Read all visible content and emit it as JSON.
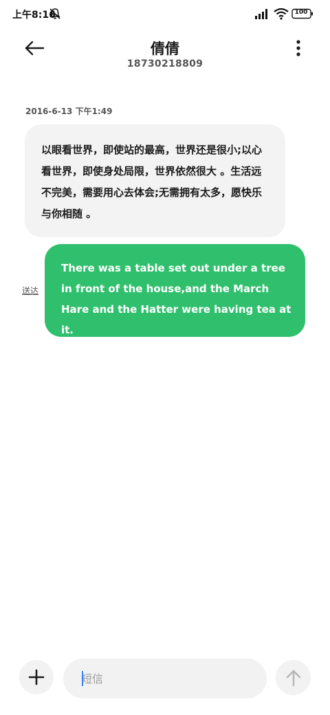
{
  "status_bar": {
    "time": "上午8:16",
    "battery_level": "100",
    "icons": [
      "mute-icon",
      "signal-icon",
      "wifi-icon",
      "battery-icon"
    ]
  },
  "header": {
    "contact_name": "倩倩",
    "contact_number": "18730218809",
    "icons": [
      "back-arrow-icon",
      "more-vert-icon"
    ]
  },
  "conversation": {
    "timestamp": "2016-6-13 下午1:49",
    "received_message": "以眼看世界，即使站的最高，世界还是很小;以心看世界，即使身处局限，世界依然很大 。生活远不完美，需要用心去体会;无需拥有太多，愿快乐与你相随 。",
    "sent_message": "There was a table set out under a tree in front of the house,and the March Hare and the Hatter were having tea at it.",
    "sent_status": "送达"
  },
  "composer": {
    "placeholder": "短信",
    "value": "",
    "icons": [
      "plus-icon",
      "send-arrow-icon"
    ]
  },
  "colors": {
    "sent_bubble": "#30c06d",
    "received_bubble": "#f3f3f3",
    "background": "#ffffff",
    "caret": "#3b82f6"
  }
}
